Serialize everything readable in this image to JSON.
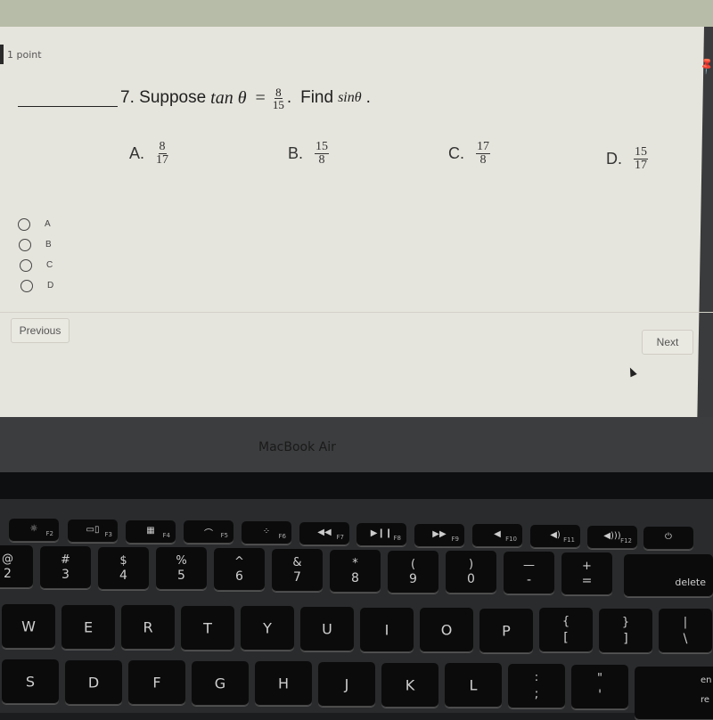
{
  "quiz": {
    "points_label": "1 point",
    "question": {
      "number_label": "7.",
      "prefix": "Suppose",
      "func": "tan θ",
      "equals": "=",
      "given_fraction": {
        "numerator": "8",
        "denominator": "15"
      },
      "find_label": "Find",
      "target": "sinθ",
      "end": "."
    },
    "choices": [
      {
        "letter": "A.",
        "numerator": "8",
        "denominator": "17"
      },
      {
        "letter": "B.",
        "numerator": "15",
        "denominator": "8"
      },
      {
        "letter": "C.",
        "numerator": "17",
        "denominator": "8"
      },
      {
        "letter": "D.",
        "numerator": "15",
        "denominator": "17"
      }
    ],
    "options": [
      "A",
      "B",
      "C",
      "D"
    ],
    "selected_option": null,
    "buttons": {
      "previous": "Previous",
      "next": "Next"
    },
    "pin_icon": "📌"
  },
  "laptop": {
    "brand": "MacBook Air",
    "function_row": [
      {
        "icon": "☼",
        "fn": "F2",
        "name": "brightness-up"
      },
      {
        "icon": "▭▯",
        "fn": "F3",
        "name": "mission-control"
      },
      {
        "icon": "▦",
        "fn": "F4",
        "name": "launchpad"
      },
      {
        "icon": "⌒",
        "fn": "F5",
        "name": "kbd-light-down"
      },
      {
        "icon": "⁘",
        "fn": "F6",
        "name": "kbd-light-up"
      },
      {
        "icon": "◀◀",
        "fn": "F7",
        "name": "rewind"
      },
      {
        "icon": "▶❙❙",
        "fn": "F8",
        "name": "play-pause"
      },
      {
        "icon": "▶▶",
        "fn": "F9",
        "name": "fast-forward"
      },
      {
        "icon": "◀",
        "fn": "F10",
        "name": "mute"
      },
      {
        "icon": "◀)",
        "fn": "F11",
        "name": "volume-down"
      },
      {
        "icon": "◀)))",
        "fn": "F12",
        "name": "volume-up"
      },
      {
        "icon": "⏻",
        "fn": "",
        "name": "power"
      }
    ],
    "number_row": [
      {
        "top": "@",
        "bot": "2"
      },
      {
        "top": "#",
        "bot": "3"
      },
      {
        "top": "$",
        "bot": "4"
      },
      {
        "top": "%",
        "bot": "5"
      },
      {
        "top": "^",
        "bot": "6"
      },
      {
        "top": "&",
        "bot": "7"
      },
      {
        "top": "*",
        "bot": "8"
      },
      {
        "top": "(",
        "bot": "9"
      },
      {
        "top": ")",
        "bot": "0"
      },
      {
        "top": "—",
        "bot": "-"
      },
      {
        "top": "+",
        "bot": "="
      }
    ],
    "delete_label": "delete",
    "qwerty_row": [
      "W",
      "E",
      "R",
      "T",
      "Y",
      "U",
      "I",
      "O",
      "P"
    ],
    "bracket_keys": [
      {
        "top": "{",
        "bot": "["
      },
      {
        "top": "}",
        "bot": "]"
      },
      {
        "top": "|",
        "bot": "\\"
      }
    ],
    "home_row": [
      "S",
      "D",
      "F",
      "G",
      "H",
      "J",
      "K",
      "L"
    ],
    "punct_keys": [
      {
        "top": ":",
        "bot": ";"
      },
      {
        "top": "\"",
        "bot": "'"
      }
    ],
    "return_label_partial": "en\nre"
  }
}
